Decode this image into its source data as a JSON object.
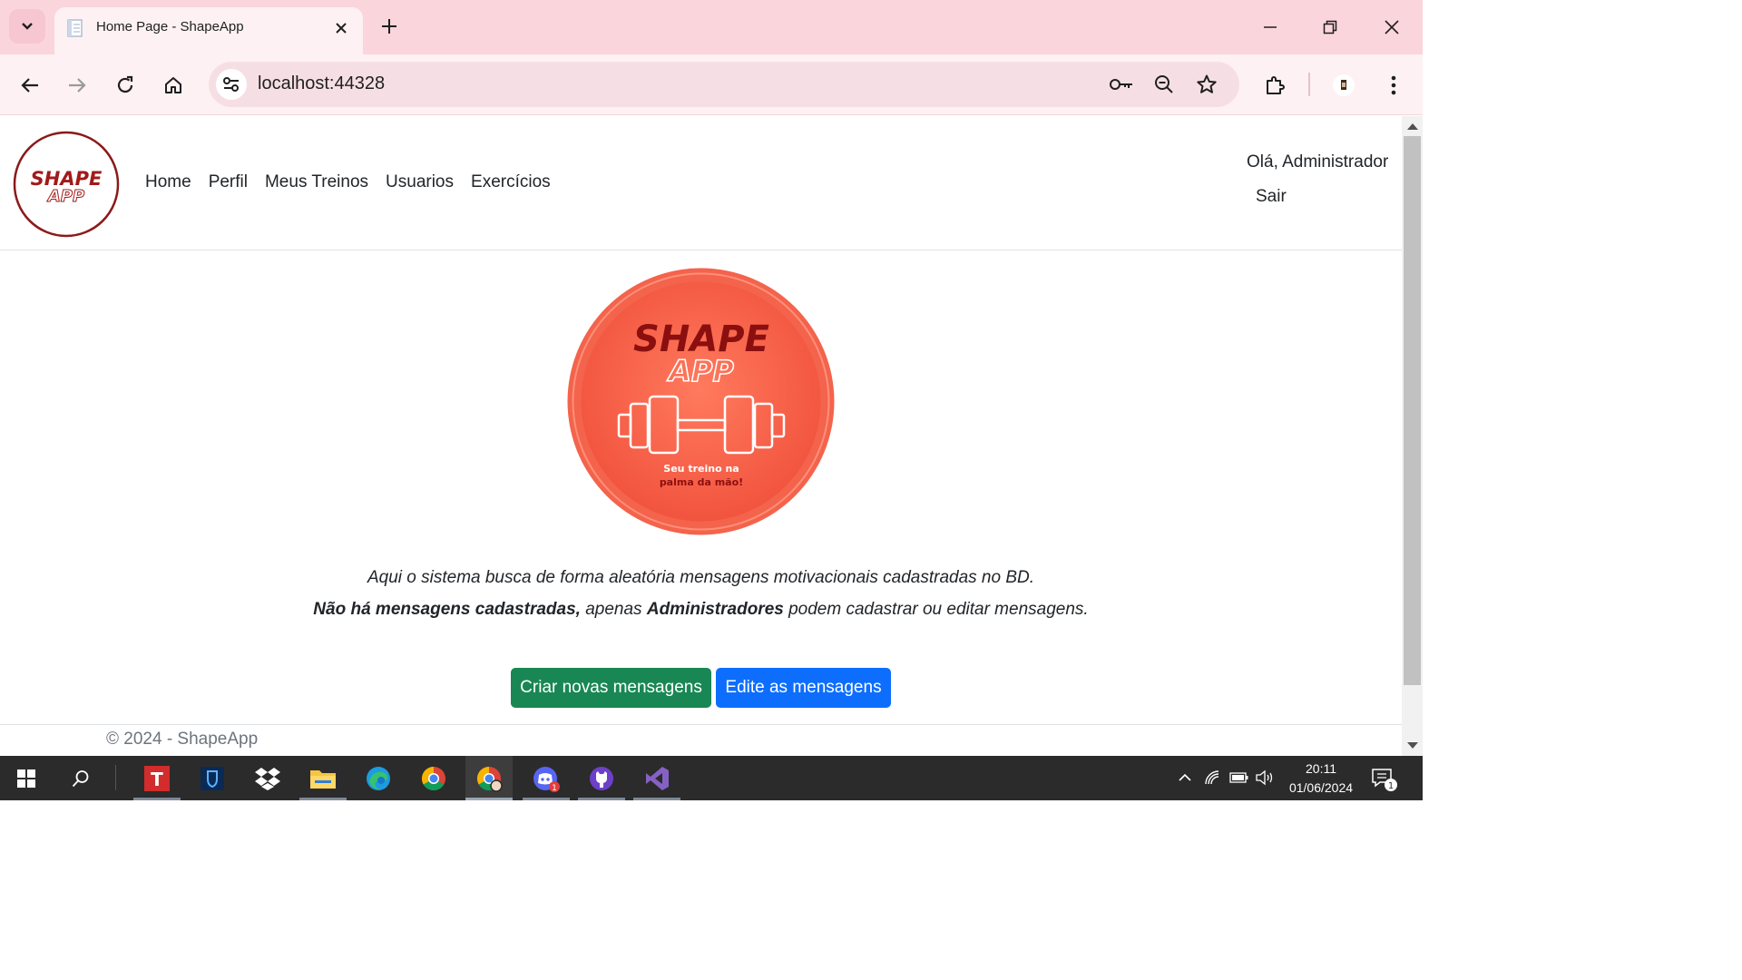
{
  "browser": {
    "tab_title": "Home Page - ShapeApp",
    "url": "localhost:44328"
  },
  "navbar": {
    "brand_text_top": "SHAPE",
    "brand_text_bottom": "APP",
    "links": [
      "Home",
      "Perfil",
      "Meus Treinos",
      "Usuarios",
      "Exercícios"
    ],
    "greeting": "Olá, Administrador",
    "logout": "Sair"
  },
  "hero": {
    "logo_text_top": "SHAPE",
    "logo_text_bottom": "APP",
    "tagline_line1": "Seu treino na",
    "tagline_line2": "palma da mão!"
  },
  "main": {
    "message_line": "Aqui o sistema busca de forma aleatória mensagens motivacionais cadastradas no BD.",
    "notice_bold1": "Não há mensagens cadastradas,",
    "notice_text1": " apenas ",
    "notice_bold2": "Administradores",
    "notice_text2": " podem cadastrar ou editar mensagens.",
    "create_button": "Criar novas mensagens",
    "edit_button": "Edite as mensagens"
  },
  "footer": {
    "text": "© 2024 - ShapeApp"
  },
  "taskbar": {
    "time": "20:11",
    "date": "01/06/2024",
    "notification_count": "1",
    "discord_badge": "1"
  },
  "colors": {
    "brand_red": "#8b1a1a",
    "hero_coral": "#f4634c",
    "btn_green": "#198754",
    "btn_blue": "#0d6efd",
    "chrome_pink": "#fbd5dc"
  }
}
